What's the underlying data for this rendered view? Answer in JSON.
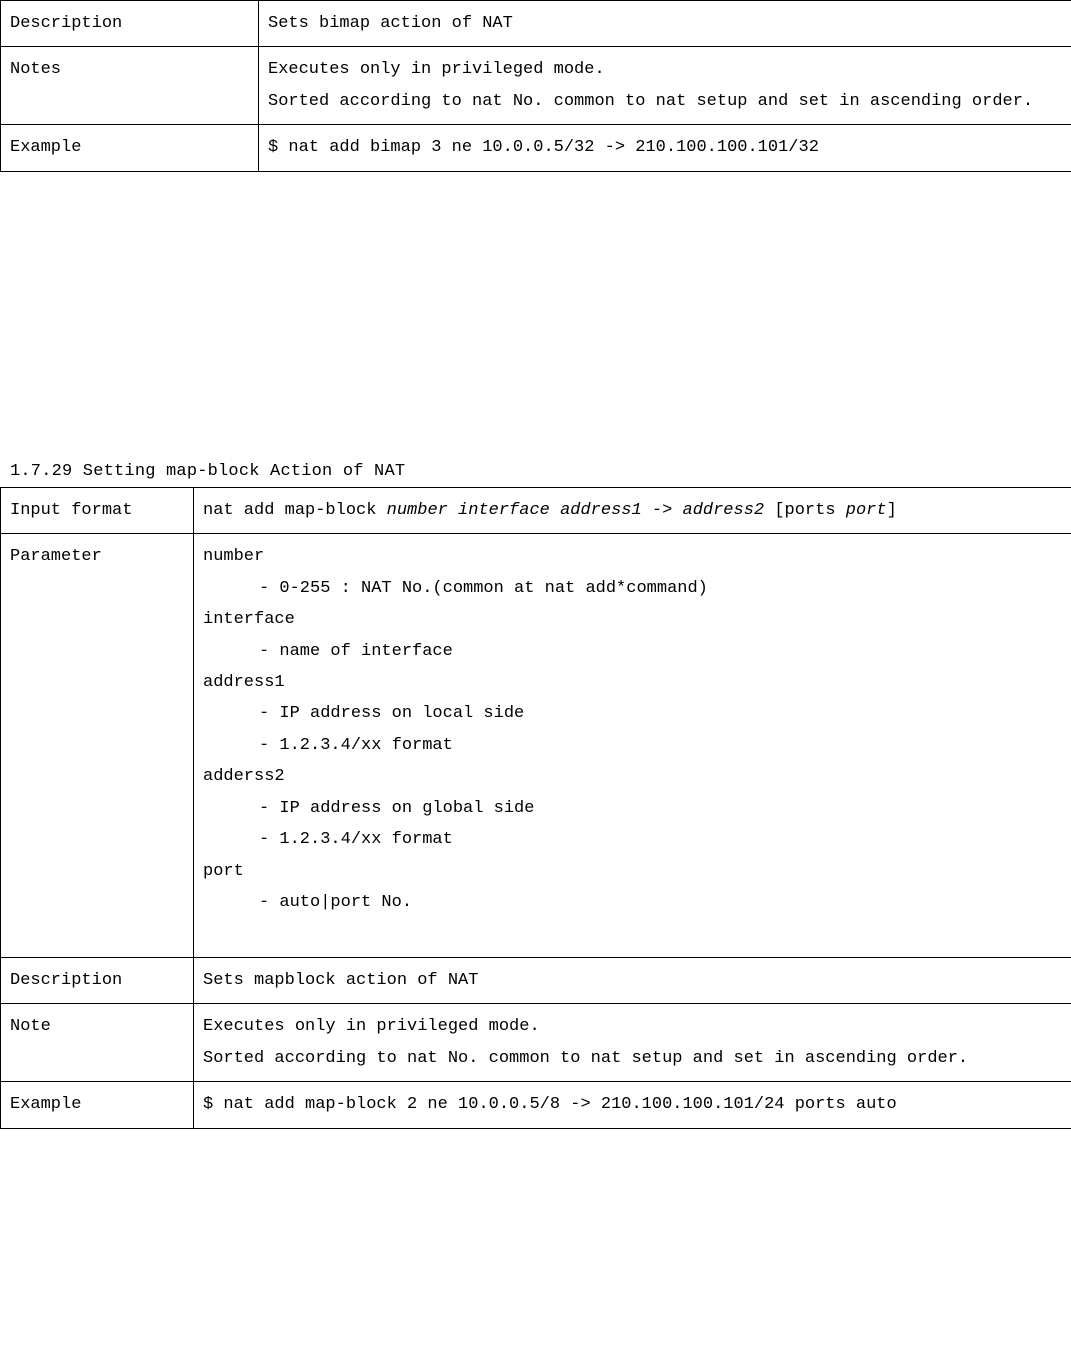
{
  "table1": {
    "rows": [
      {
        "label": "Description",
        "value": "Sets bimap action of NAT"
      },
      {
        "label": "Notes",
        "lines": [
          "Executes only in privileged mode.",
          "Sorted according to nat No. common to nat setup and set in ascending order."
        ]
      },
      {
        "label": "Example",
        "value": "$ nat add bimap 3 ne 10.0.0.5/32 -> 210.100.100.101/32"
      }
    ]
  },
  "section2": {
    "heading": "1.7.29 Setting map-block Action of NAT"
  },
  "table2": {
    "input_format": {
      "label": "Input format",
      "prefix": "nat add map-block ",
      "italic1": "number interface address1",
      "mid": " -> ",
      "italic2": "address2",
      "after": " [ports ",
      "italic3": "port",
      "suffix": "]"
    },
    "parameter": {
      "label": "Parameter",
      "items": [
        {
          "name": "number",
          "subs": [
            "- 0-255 : NAT No.(common at nat add*command)"
          ]
        },
        {
          "name": "interface",
          "subs": [
            "- name of interface"
          ]
        },
        {
          "name": "address1",
          "subs": [
            "- IP address on local side",
            "- 1.2.3.4/xx format"
          ]
        },
        {
          "name": "adderss2",
          "subs": [
            "- IP address on global side",
            "- 1.2.3.4/xx format"
          ]
        },
        {
          "name": "port",
          "subs": [
            "- auto|port No."
          ]
        }
      ]
    },
    "description": {
      "label": "Description",
      "value": "Sets mapblock action of NAT"
    },
    "note": {
      "label": "Note",
      "lines": [
        "Executes only in privileged mode.",
        "Sorted according to nat No. common to nat setup and set in ascending order."
      ]
    },
    "example": {
      "label": "Example",
      "value": "$ nat add map-block 2 ne 10.0.0.5/8 -> 210.100.100.101/24 ports auto"
    }
  }
}
